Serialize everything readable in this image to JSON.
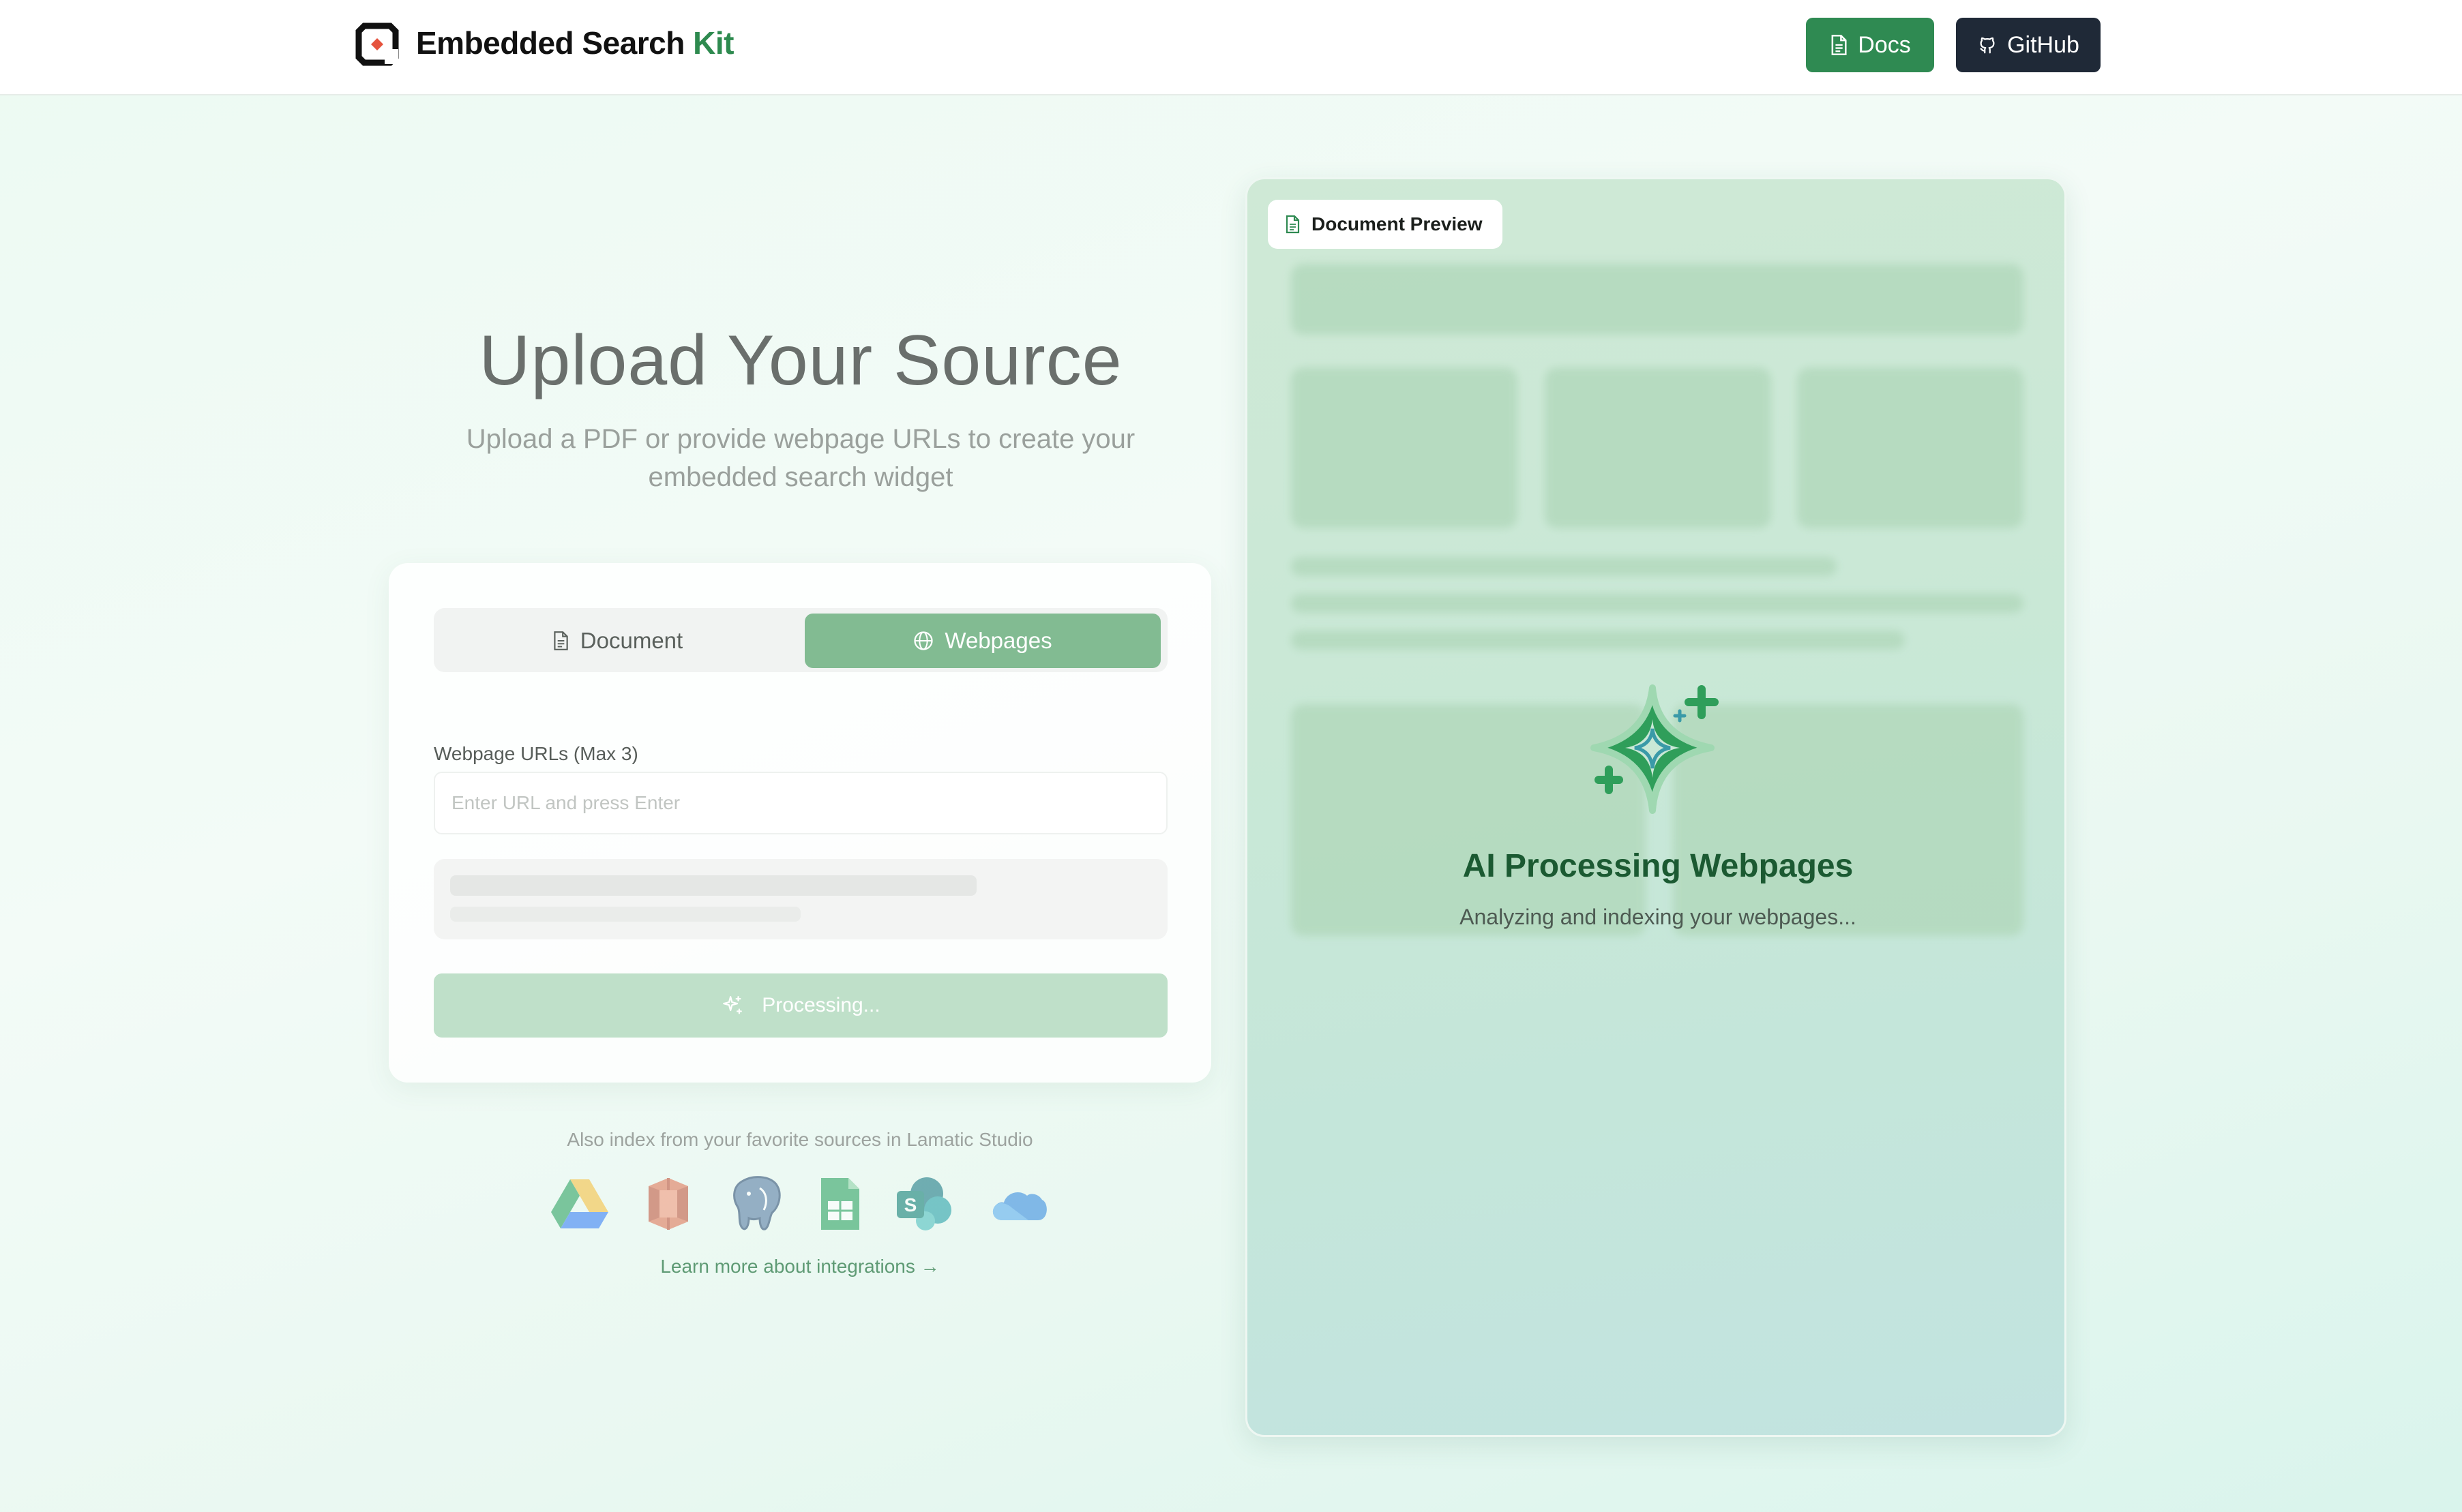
{
  "header": {
    "brand_main": "Embedded Search",
    "brand_accent": "Kit",
    "docs_label": "Docs",
    "github_label": "GitHub"
  },
  "hero": {
    "title": "Upload Your Source",
    "subtitle": "Upload a PDF or provide webpage URLs to create your embedded search widget"
  },
  "upload_card": {
    "tabs": [
      {
        "label": "Document",
        "icon": "file-icon",
        "active": false
      },
      {
        "label": "Webpages",
        "icon": "globe-icon",
        "active": true
      }
    ],
    "url_field_label": "Webpage URLs (Max 3)",
    "url_placeholder": "Enter URL and press Enter",
    "url_value": "",
    "submit_label": "Processing..."
  },
  "integrations": {
    "intro": "Also index from your favorite sources in Lamatic Studio",
    "sources": [
      "google-drive-icon",
      "aws-s3-icon",
      "postgresql-icon",
      "google-sheets-icon",
      "sharepoint-icon",
      "onedrive-icon"
    ],
    "learn_more": "Learn more about integrations →"
  },
  "preview": {
    "tag_label": "Document Preview",
    "status_title": "AI Processing Webpages",
    "status_subtitle": "Analyzing and indexing your webpages..."
  },
  "colors": {
    "brand_green": "#2f8a52",
    "dark_button": "#1f2937",
    "active_tab": "#82bb92",
    "processing_button": "#bfe0c9",
    "preview_title": "#1b5a32"
  }
}
